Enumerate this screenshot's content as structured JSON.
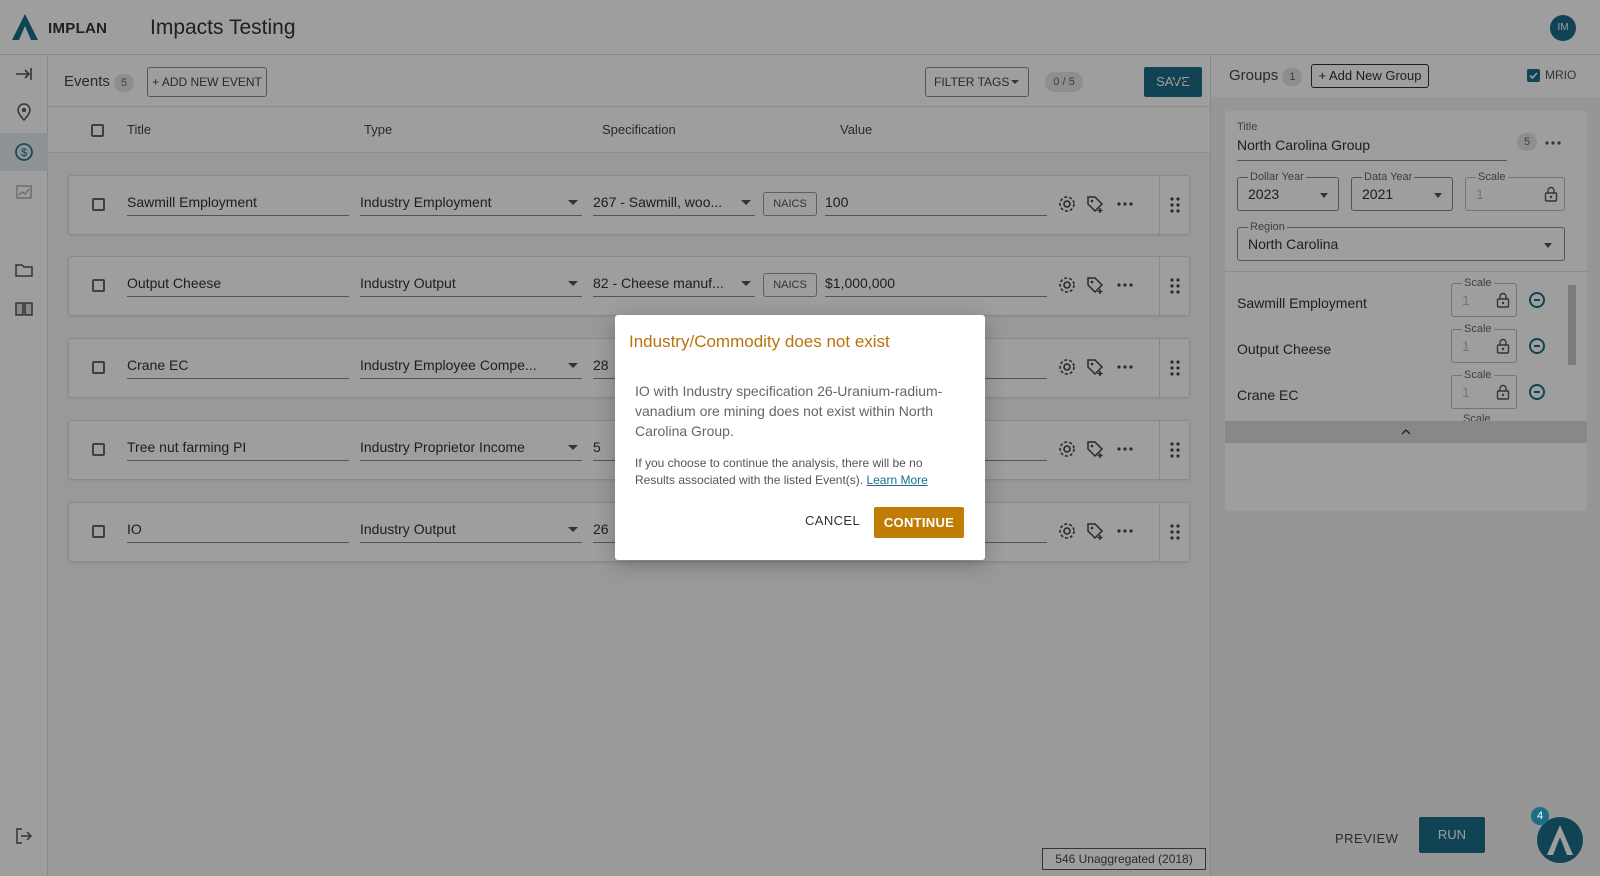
{
  "app": {
    "brand": "IMPLAN",
    "title": "Impacts Testing",
    "avatar_initials": "IM"
  },
  "nav": {
    "icons": [
      "expand-icon",
      "location-pin-icon",
      "dollar-circle-icon",
      "chart-icon",
      "folder-icon",
      "book-icon",
      "logout-icon"
    ]
  },
  "events": {
    "label": "Events",
    "count": "5",
    "add_button": "+ ADD NEW EVENT",
    "filter_tags": "FILTER TAGS",
    "selection_count": "0 / 5",
    "save": "SAVE",
    "columns": [
      "Title",
      "Type",
      "Specification",
      "Value"
    ],
    "rows": [
      {
        "title": "Sawmill Employment",
        "type": "Industry Employment",
        "spec": "267 - Sawmill, woo...",
        "spec_tag": "NAICS",
        "value": "100"
      },
      {
        "title": "Output Cheese",
        "type": "Industry Output",
        "spec": "82 - Cheese manuf...",
        "spec_tag": "NAICS",
        "value": "$1,000,000"
      },
      {
        "title": "Crane EC",
        "type": "Industry Employee Compe...",
        "spec": "28",
        "spec_tag": "",
        "value": ""
      },
      {
        "title": "Tree nut farming PI",
        "type": "Industry Proprietor Income",
        "spec": "5",
        "spec_tag": "",
        "value": ""
      },
      {
        "title": "IO",
        "type": "Industry Output",
        "spec": "26",
        "spec_tag": "",
        "value": ""
      }
    ]
  },
  "status_bar": "546 Unaggregated (2018)",
  "groups": {
    "label": "Groups",
    "count": "1",
    "add_button": "+ Add New Group",
    "mrio_label": "MRIO",
    "card": {
      "title_label": "Title",
      "title_value": "North Carolina Group",
      "event_count": "5",
      "dollar_year_label": "Dollar Year",
      "dollar_year": "2023",
      "data_year_label": "Data Year",
      "data_year": "2021",
      "scale_label": "Scale",
      "scale_value": "1",
      "region_label": "Region",
      "region": "North Carolina",
      "events": [
        {
          "name": "Sawmill Employment",
          "scale_label": "Scale",
          "scale": "1"
        },
        {
          "name": "Output Cheese",
          "scale_label": "Scale",
          "scale": "1"
        },
        {
          "name": "Crane EC",
          "scale_label": "Scale",
          "scale": "1"
        }
      ],
      "extra_scale_label": "Scale"
    },
    "preview": "PREVIEW",
    "run": "RUN",
    "fab_badge": "4"
  },
  "modal": {
    "title": "Industry/Commodity does not exist",
    "body1": "IO with Industry specification 26-Uranium-radium-vanadium ore mining does not exist within North Carolina Group.",
    "body2": "If you choose to continue the analysis, there will be no Results associated with the listed Event(s).",
    "learn_more": "Learn More",
    "cancel": "CANCEL",
    "continue": "CONTINUE"
  },
  "colors": {
    "accent": "#1b6f88",
    "warning": "#b8740a",
    "continue": "#c07d06"
  }
}
